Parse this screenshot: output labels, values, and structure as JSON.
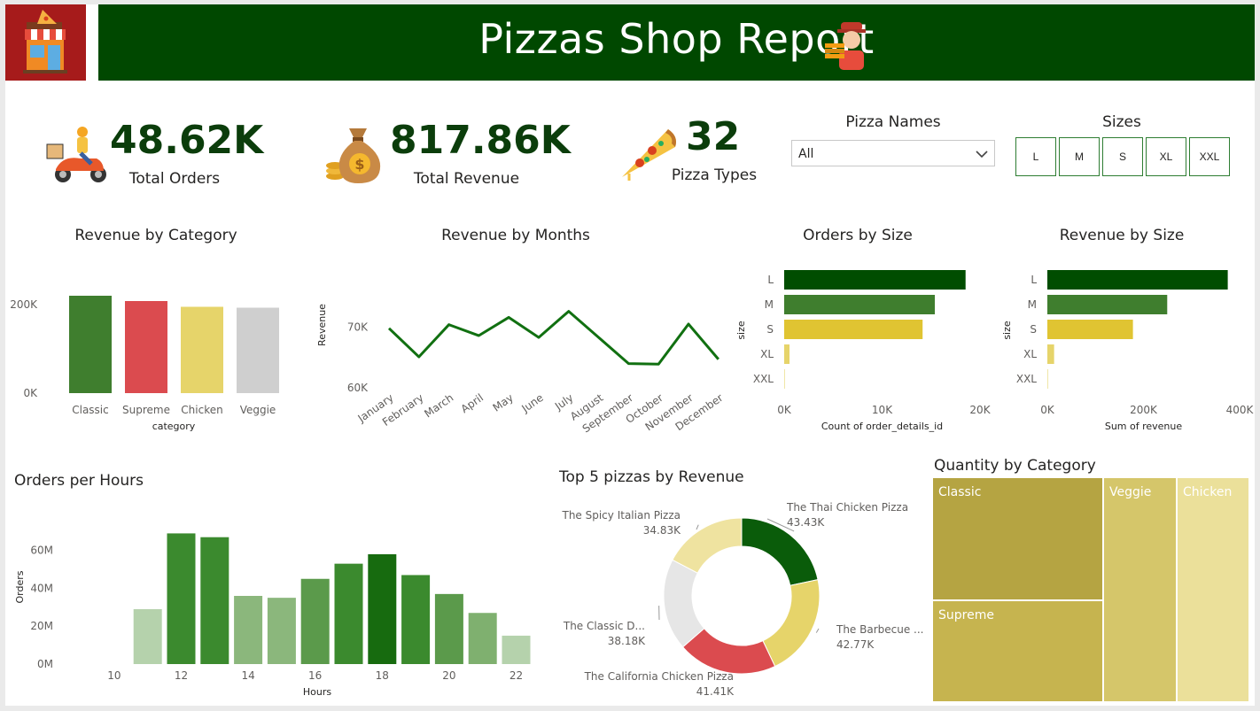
{
  "header": {
    "title": "Pizzas Shop Report"
  },
  "kpis": [
    {
      "value": "48.62K",
      "label": "Total Orders",
      "icon": "delivery-scooter-icon"
    },
    {
      "value": "817.86K",
      "label": "Total Revenue",
      "icon": "money-bag-icon"
    },
    {
      "value": "32",
      "label": "Pizza Types",
      "icon": "pizza-slice-icon"
    }
  ],
  "slicers": {
    "pizza_names": {
      "title": "Pizza Names",
      "selected": "All"
    },
    "sizes": {
      "title": "Sizes",
      "options": [
        "L",
        "M",
        "S",
        "XL",
        "XXL"
      ]
    }
  },
  "colors": {
    "header_green": "#004800",
    "logo_red": "#a61b1b",
    "dark_green": "#004d00",
    "mid_green": "#3f7e2e",
    "yellow": "#e0c432",
    "red": "#db4b4f",
    "gray": "#cfcfcf"
  },
  "chart_data": [
    {
      "id": "revenue_by_category",
      "type": "bar",
      "title": "Revenue by Category",
      "xlabel": "category",
      "categories": [
        "Classic",
        "Supreme",
        "Chicken",
        "Veggie"
      ],
      "values": [
        220000,
        208000,
        195000,
        193000
      ],
      "colors": [
        "#3f7e2e",
        "#db4b4f",
        "#e6d46a",
        "#cfcfcf"
      ],
      "ylim": [
        0,
        260000
      ],
      "yticks": [
        "0K",
        "200K"
      ]
    },
    {
      "id": "revenue_by_months",
      "type": "line",
      "title": "Revenue by Months",
      "ylabel": "Revenue",
      "categories": [
        "January",
        "February",
        "March",
        "April",
        "May",
        "June",
        "July",
        "August",
        "September",
        "October",
        "November",
        "December"
      ],
      "values": [
        69800,
        65100,
        70400,
        68600,
        71600,
        68300,
        72600,
        68300,
        64000,
        63900,
        70500,
        64700
      ],
      "ylim": [
        60000,
        74000
      ],
      "yticks": [
        "60K",
        "70K"
      ]
    },
    {
      "id": "orders_by_size",
      "type": "bar",
      "orientation": "horizontal",
      "title": "Orders by Size",
      "ylabel": "size",
      "xlabel": "Count of order_details_id",
      "categories": [
        "L",
        "M",
        "S",
        "XL",
        "XXL"
      ],
      "values": [
        18526,
        15385,
        14137,
        544,
        28
      ],
      "colors": [
        "#004d00",
        "#3f7e2e",
        "#e0c432",
        "#e6d46a",
        "#f0e6a8"
      ],
      "xlim": [
        0,
        20000
      ],
      "xticks": [
        "0K",
        "10K",
        "20K"
      ]
    },
    {
      "id": "revenue_by_size",
      "type": "bar",
      "orientation": "horizontal",
      "title": "Revenue by Size",
      "ylabel": "size",
      "xlabel": "Sum of revenue",
      "categories": [
        "L",
        "M",
        "S",
        "XL",
        "XXL"
      ],
      "values": [
        375319,
        249382,
        178076,
        14076,
        1007
      ],
      "colors": [
        "#004d00",
        "#3f7e2e",
        "#e0c432",
        "#e6d46a",
        "#f0e6a8"
      ],
      "xlim": [
        0,
        400000
      ],
      "xticks": [
        "0K",
        "200K",
        "400K"
      ]
    },
    {
      "id": "orders_per_hours",
      "type": "bar",
      "title": "Orders per Hours",
      "xlabel": "Hours",
      "ylabel": "Orders",
      "categories": [
        "9",
        "10",
        "11",
        "12",
        "13",
        "14",
        "15",
        "16",
        "17",
        "18",
        "19",
        "20",
        "21",
        "22",
        "23"
      ],
      "values": [
        0,
        0,
        29,
        69,
        67,
        36,
        35,
        45,
        53,
        58,
        47,
        37,
        27,
        15,
        0
      ],
      "colors": [
        "#b5d2ac",
        "#b5d2ac",
        "#b5d2ac",
        "#3b8a2e",
        "#3b8a2e",
        "#8bb77c",
        "#8bb77c",
        "#5b9a4b",
        "#3b8a2e",
        "#176b0f",
        "#3b8a2e",
        "#5b9a4b",
        "#7fb06f",
        "#b5d2ac",
        "#b5d2ac"
      ],
      "ylim": [
        0,
        72
      ],
      "yticks": [
        "0M",
        "20M",
        "40M",
        "60M"
      ],
      "xticks": [
        "10",
        "12",
        "14",
        "16",
        "18",
        "20",
        "22"
      ]
    },
    {
      "id": "top5_pizzas_by_revenue",
      "type": "pie",
      "donut": true,
      "title": "Top 5 pizzas by Revenue",
      "categories": [
        "The Thai Chicken Pizza",
        "The Barbecue ...",
        "The California Chicken Pizza",
        "The Classic D...",
        "The Spicy Italian Pizza"
      ],
      "values": [
        43.43,
        42.77,
        41.41,
        38.18,
        34.83
      ],
      "labels": [
        "43.43K",
        "42.77K",
        "41.41K",
        "38.18K",
        "34.83K"
      ],
      "colors": [
        "#0a5c0a",
        "#e6d46a",
        "#db4b4f",
        "#e6e6e6",
        "#efe3a0"
      ]
    },
    {
      "id": "quantity_by_category",
      "type": "heatmap",
      "subtype": "treemap",
      "title": "Quantity by Category",
      "categories": [
        "Classic",
        "Supreme",
        "Veggie",
        "Chicken"
      ],
      "values": [
        14888,
        11987,
        11649,
        11050
      ],
      "colors": [
        "#b5a442",
        "#c6b44f",
        "#d5c66a",
        "#ebe09a"
      ]
    }
  ]
}
